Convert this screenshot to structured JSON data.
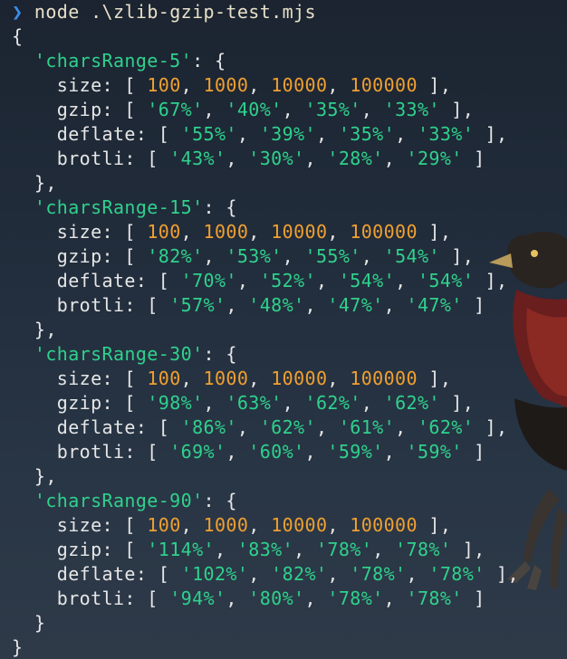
{
  "terminal": {
    "prompt_symbol": "❯",
    "command": "node .\\zlib-gzip-test.mjs",
    "open_brace": "{",
    "close_brace": "}",
    "groups": [
      {
        "name": "'charsRange-5'",
        "size": [
          "100",
          "1000",
          "10000",
          "100000"
        ],
        "gzip": [
          "'67%'",
          "'40%'",
          "'35%'",
          "'33%'"
        ],
        "deflate": [
          "'55%'",
          "'39%'",
          "'35%'",
          "'33%'"
        ],
        "brotli": [
          "'43%'",
          "'30%'",
          "'28%'",
          "'29%'"
        ]
      },
      {
        "name": "'charsRange-15'",
        "size": [
          "100",
          "1000",
          "10000",
          "100000"
        ],
        "gzip": [
          "'82%'",
          "'53%'",
          "'55%'",
          "'54%'"
        ],
        "deflate": [
          "'70%'",
          "'52%'",
          "'54%'",
          "'54%'"
        ],
        "brotli": [
          "'57%'",
          "'48%'",
          "'47%'",
          "'47%'"
        ]
      },
      {
        "name": "'charsRange-30'",
        "size": [
          "100",
          "1000",
          "10000",
          "100000"
        ],
        "gzip": [
          "'98%'",
          "'63%'",
          "'62%'",
          "'62%'"
        ],
        "deflate": [
          "'86%'",
          "'62%'",
          "'61%'",
          "'62%'"
        ],
        "brotli": [
          "'69%'",
          "'60%'",
          "'59%'",
          "'59%'"
        ]
      },
      {
        "name": "'charsRange-90'",
        "size": [
          "100",
          "1000",
          "10000",
          "100000"
        ],
        "gzip": [
          "'114%'",
          "'83%'",
          "'78%'",
          "'78%'"
        ],
        "deflate": [
          "'102%'",
          "'82%'",
          "'78%'",
          "'78%'"
        ],
        "brotli": [
          "'94%'",
          "'80%'",
          "'78%'",
          "'78%'"
        ]
      }
    ]
  },
  "colors": {
    "number": "#f0a030",
    "string": "#2fd18c",
    "prompt": "#3b8eea",
    "text": "#e6e6e6"
  }
}
